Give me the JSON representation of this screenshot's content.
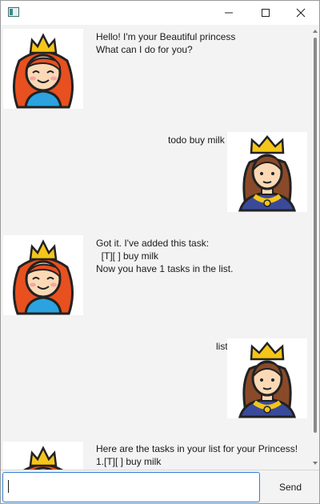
{
  "window": {
    "controls": {
      "minimize": "minimize",
      "maximize": "maximize",
      "close": "close"
    }
  },
  "messages": [
    {
      "sender": "bot",
      "lines": [
        "Hello! I'm your Beautiful princess",
        "What can I do for you?"
      ]
    },
    {
      "sender": "user",
      "lines": [
        "todo buy milk"
      ]
    },
    {
      "sender": "bot",
      "lines": [
        "Got it. I've added this task:",
        "  [T][ ] buy milk",
        "Now you have 1 tasks in the list."
      ]
    },
    {
      "sender": "user",
      "lines": [
        "list"
      ]
    },
    {
      "sender": "bot",
      "lines": [
        "Here are the tasks in your list for your Princess!",
        "1.[T][ ] buy milk"
      ]
    }
  ],
  "input": {
    "value": "",
    "placeholder": ""
  },
  "send_button": {
    "label": "Send"
  },
  "icons": {
    "bot_avatar": "princess-avatar-icon",
    "user_avatar": "queen-avatar-icon"
  },
  "colors": {
    "crown": "#f5c518",
    "bot_hair": "#e8501f",
    "bot_dress": "#2aa3e0",
    "user_hair": "#8a4a2a",
    "user_dress": "#3a4a9a",
    "input_focus": "#2f7fd6"
  }
}
